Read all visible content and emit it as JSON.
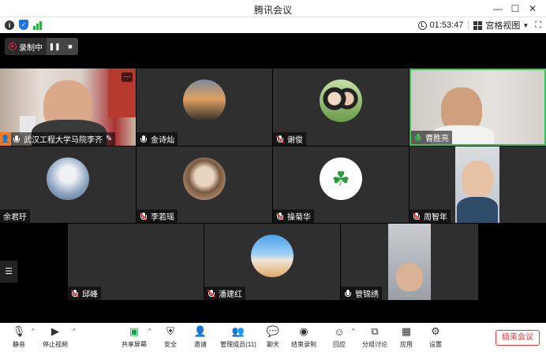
{
  "window": {
    "title": "腾讯会议"
  },
  "info": {
    "timer": "01:53:47",
    "view_label": "宫格视图"
  },
  "recording": {
    "label": "录制中"
  },
  "participants": [
    {
      "name": "武汉工程大学马院李齐",
      "host": true,
      "mic": "on"
    },
    {
      "name": "金诗灿",
      "mic": "on"
    },
    {
      "name": "谢俊",
      "mic": "muted"
    },
    {
      "name": "曹胜亮",
      "mic": "active",
      "speaking": true
    },
    {
      "name": "余君玗",
      "mic": "none"
    },
    {
      "name": "李若瑶",
      "mic": "muted"
    },
    {
      "name": "操菊华",
      "mic": "muted"
    },
    {
      "name": "周智年",
      "mic": "muted"
    },
    {
      "name": "邱峰",
      "mic": "muted"
    },
    {
      "name": "潘建红",
      "mic": "muted"
    },
    {
      "name": "管锦绣",
      "mic": "on"
    }
  ],
  "toolbar": {
    "mute": "静音",
    "stop_video": "停止视频",
    "share_screen": "共享屏幕",
    "security": "安全",
    "invite": "邀请",
    "manage_members": "管理成员(11)",
    "chat": "聊天",
    "end_recording": "结束录制",
    "reactions": "回应",
    "breakout": "分组讨论",
    "apps": "应用",
    "settings": "设置",
    "end_meeting": "结束会议"
  },
  "colors": {
    "accent": "#1a73e8",
    "active_border": "#3fbf5a",
    "end": "#e33333",
    "host": "#f07b20"
  }
}
